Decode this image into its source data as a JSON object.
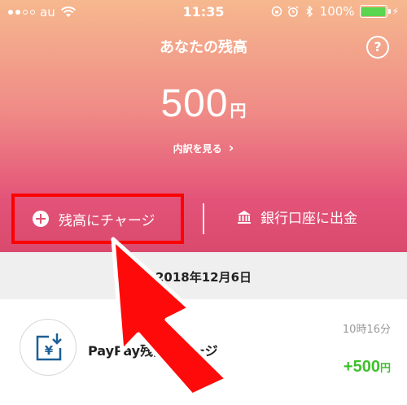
{
  "status_bar": {
    "carrier": "au",
    "time": "11:35",
    "battery": "100%",
    "battery_level": 1.0,
    "icons": [
      "signal-icon",
      "wifi-icon",
      "orientation-lock-icon",
      "alarm-icon",
      "bluetooth-icon",
      "battery-icon",
      "charging-bolt-icon"
    ]
  },
  "header": {
    "title": "あなたの残高",
    "help_label": "?",
    "balance_amount": "500",
    "balance_unit": "円",
    "breakdown_link": "内訳を見る",
    "breakdown_chevron": "›"
  },
  "actions": {
    "charge_label": "残高にチャージ",
    "withdraw_label": "銀行口座に出金"
  },
  "history": {
    "date": "2018年12月6日",
    "transactions": [
      {
        "name": "PayPay残高チャージ",
        "time": "10時16分",
        "amount": "+500",
        "unit": "円"
      }
    ]
  },
  "colors": {
    "header_top": "#f6b88e",
    "header_bottom": "#d94a6d",
    "highlight": "#ff0000",
    "positive_amount": "#3fbf2d",
    "date_bar": "#efefef"
  }
}
